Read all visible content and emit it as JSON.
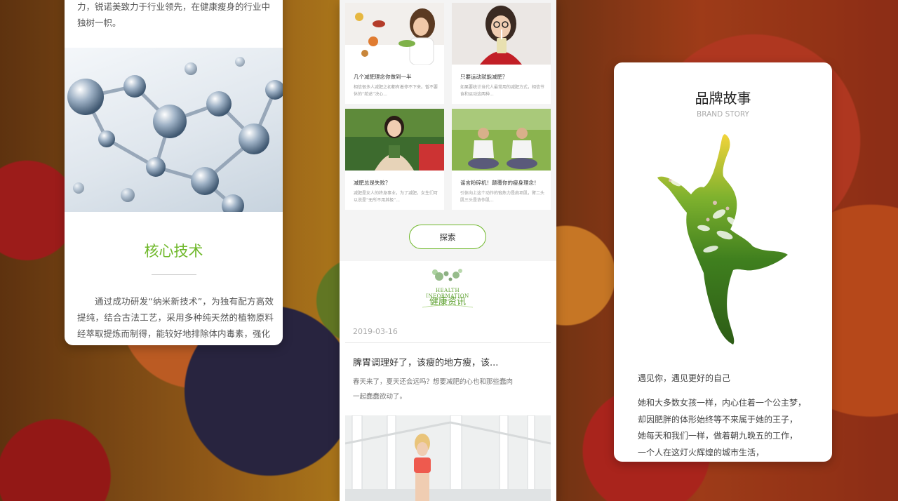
{
  "left_card": {
    "intro_text": "力，锐诺美致力于行业领先，在健康瘦身的行业中独树一帜。",
    "title": "核心技术",
    "body": "通过成功研发“纳米新技术”，为独有配方高效提纯，结合古法工艺，采用多种纯天然的植物原料经萃取提炼而制得，能较好地排除体内毒素，强化"
  },
  "middle_card": {
    "articles": [
      {
        "title": "几个减肥理念你做到一半",
        "desc": "相信很多人减肥之初都有着停不下来。暂不要休的“苑述”决心..."
      },
      {
        "title": "只要运动就能减肥？",
        "desc": "如果要统计当代人最常用的减肥方式，相信节食和运动这两种..."
      },
      {
        "title": "减肥总是失败？",
        "desc": "减肥是女人的终身事业，为了减肥，女生们可以说是“无所不用其极”..."
      },
      {
        "title": "谣言粉碎机！颠覆你的瘦身理念！",
        "desc": "引体向上这个动作的锻炼力是肩项肌，臂二头肌三头是协作肌..."
      }
    ],
    "explore_label": "探索",
    "health_info": {
      "en": "HEALTH INFORMATION",
      "cn": "健康资讯"
    },
    "news": {
      "date": "2019-03-16",
      "title": "脾胃调理好了，该瘦的地方瘦，该...",
      "desc_lines": [
        "春天来了，夏天还会远吗？想要减肥的心也和那些蠢肉",
        "一起蠢蠢欲动了。"
      ]
    }
  },
  "right_card": {
    "title": "品牌故事",
    "subtitle": "BRAND STORY",
    "lead": "遇见你，遇见更好的自己",
    "body_lines": [
      "她和大多数女孩一样，内心住着一个公主梦，",
      "却因肥胖的体形始终等不来属于她的王子，",
      "她每天和我们一样，做着朝九晚五的工作，",
      "一个人在这灯火辉煌的城市生活，"
    ]
  },
  "colors": {
    "accent_green": "#6fb82a",
    "text_dark": "#333333",
    "text_muted": "#999999"
  }
}
